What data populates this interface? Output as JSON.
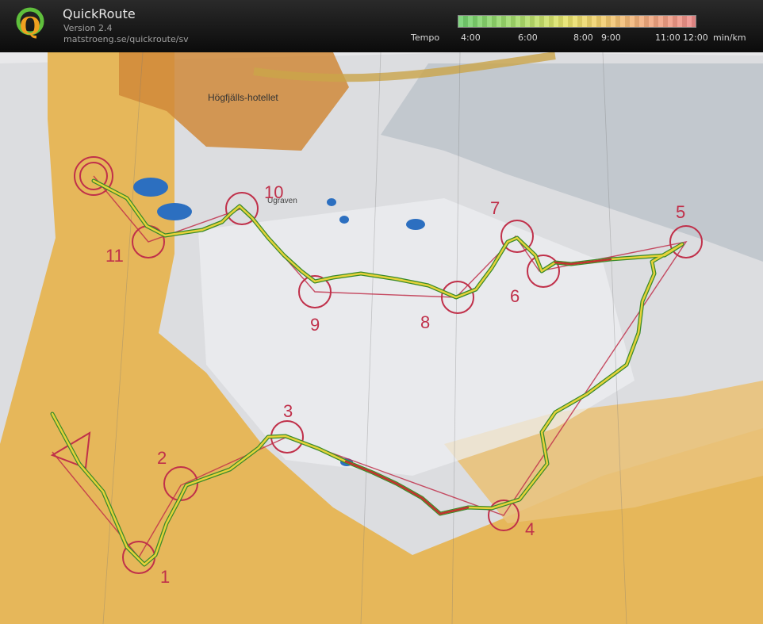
{
  "app": {
    "name": "QuickRoute",
    "version": "Version 2.4",
    "url": "matstroeng.se/quickroute/sv",
    "logo_letter": "Q"
  },
  "tempo_scale": {
    "label": "Tempo",
    "ticks": [
      "4:00",
      "6:00",
      "8:00",
      "9:00",
      "11:00",
      "12:00"
    ],
    "unit": "min/km",
    "colors": [
      "#6fcf6f",
      "#a7dc6b",
      "#e6e36a",
      "#f3cf6d",
      "#f2a97f",
      "#ee8c8c"
    ]
  },
  "map": {
    "place_label": "Högfjälls-hotellet",
    "lake_label": "Ugraven",
    "controls": [
      {
        "label": "1"
      },
      {
        "label": "2"
      },
      {
        "label": "3"
      },
      {
        "label": "4"
      },
      {
        "label": "5"
      },
      {
        "label": "6"
      },
      {
        "label": "7"
      },
      {
        "label": "8"
      },
      {
        "label": "9"
      },
      {
        "label": "10"
      },
      {
        "label": "11"
      }
    ],
    "course_color": "#c0304a",
    "route_colors": [
      "#3a8a2a",
      "#e6d23a",
      "#c03030"
    ]
  }
}
